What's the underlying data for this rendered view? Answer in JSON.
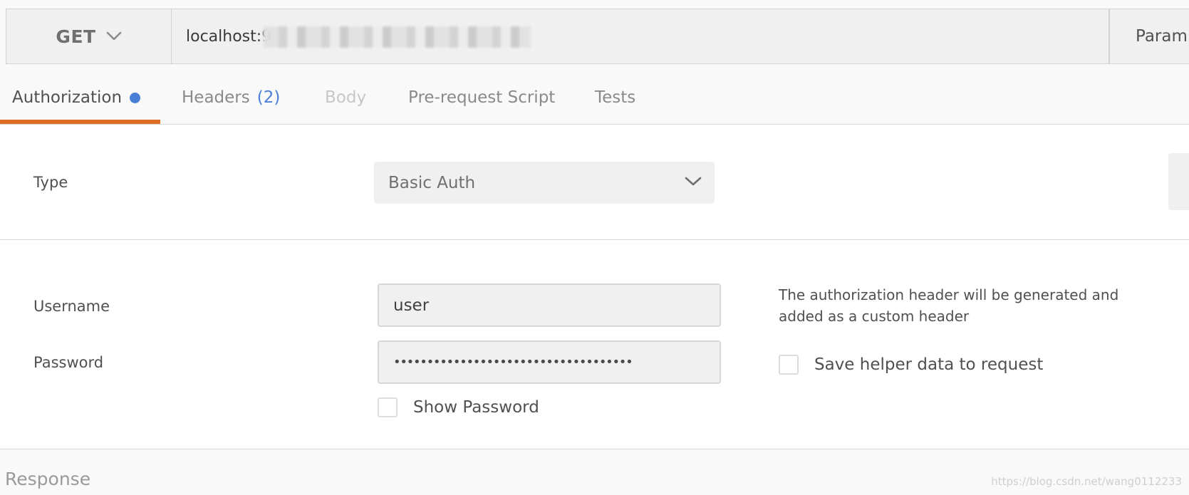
{
  "request": {
    "method": "GET",
    "url_visible": "localhost:9",
    "params_label": "Param"
  },
  "tabs": [
    {
      "label": "Authorization",
      "state": "active",
      "indicator_color": "#4a7fd8"
    },
    {
      "label": "Headers",
      "count": "(2)",
      "state": "normal"
    },
    {
      "label": "Body",
      "state": "disabled"
    },
    {
      "label": "Pre-request Script",
      "state": "normal"
    },
    {
      "label": "Tests",
      "state": "normal"
    }
  ],
  "auth": {
    "type_label": "Type",
    "type_value": "Basic Auth",
    "username_label": "Username",
    "username_value": "user",
    "password_label": "Password",
    "password_mask": "••••••••••••••••••••••••••••••••••••",
    "show_password_label": "Show Password",
    "show_password_checked": false,
    "help_text": "The authorization header will be generated and added as a custom header",
    "save_helper_label": "Save helper data to request",
    "save_helper_checked": false
  },
  "response": {
    "label": "Response"
  },
  "watermark": "https://blog.csdn.net/wang0112233",
  "colors": {
    "active_tab_underline": "#e06d24",
    "header_count": "#4a7fd8",
    "auth_indicator": "#4a7fd8"
  },
  "icons": {
    "method_dropdown": "chevron-down-icon",
    "type_dropdown": "chevron-down-icon",
    "auth_indicator": "dot-icon"
  }
}
